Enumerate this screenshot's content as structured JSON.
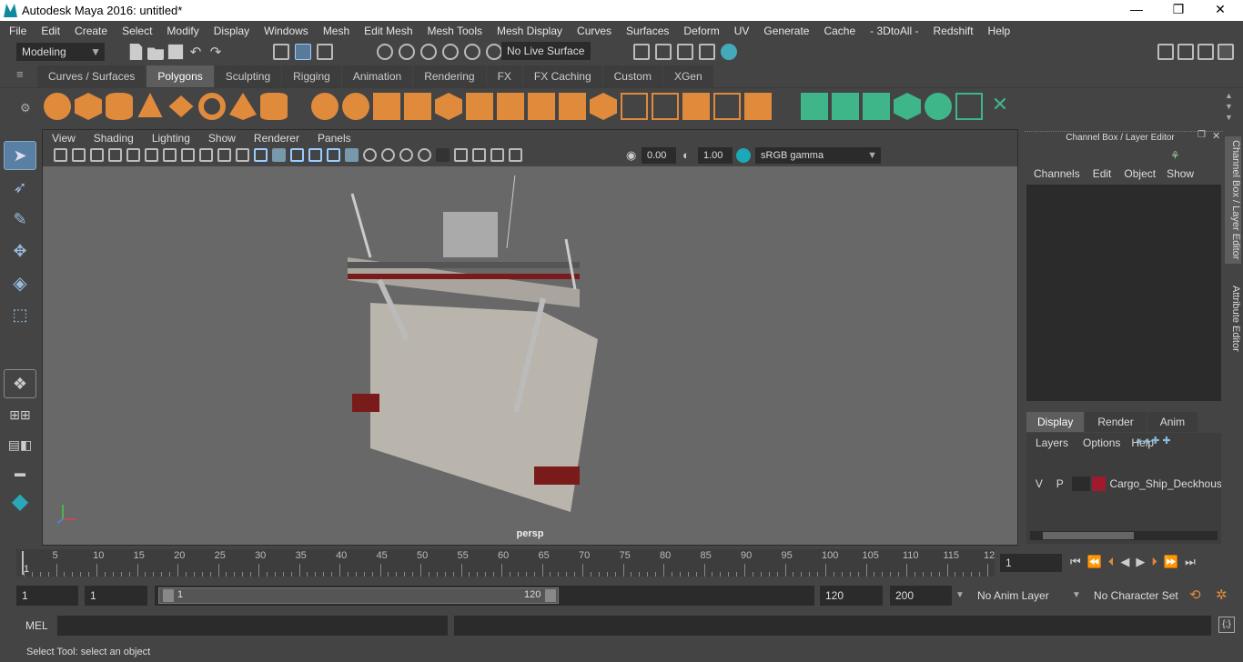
{
  "window": {
    "title": "Autodesk Maya 2016: untitled*",
    "minimize": "—",
    "maximize": "❐",
    "close": "✕"
  },
  "menu": [
    "File",
    "Edit",
    "Create",
    "Select",
    "Modify",
    "Display",
    "Windows",
    "Mesh",
    "Edit Mesh",
    "Mesh Tools",
    "Mesh Display",
    "Curves",
    "Surfaces",
    "Deform",
    "UV",
    "Generate",
    "Cache",
    "- 3DtoAll -",
    "Redshift",
    "Help"
  ],
  "status": {
    "mode": "Modeling",
    "live_surface": "No Live Surface"
  },
  "shelf_tabs": [
    "Curves / Surfaces",
    "Polygons",
    "Sculpting",
    "Rigging",
    "Animation",
    "Rendering",
    "FX",
    "FX Caching",
    "Custom",
    "XGen"
  ],
  "active_shelf": "Polygons",
  "panel_menu": [
    "View",
    "Shading",
    "Lighting",
    "Show",
    "Renderer",
    "Panels"
  ],
  "panel_tools": {
    "exposure": "0.00",
    "gamma": "1.00",
    "color_space": "sRGB gamma"
  },
  "viewport": {
    "camera": "persp"
  },
  "channel_box": {
    "title": "Channel Box / Layer Editor",
    "menu": [
      "Channels",
      "Edit",
      "Object",
      "Show"
    ],
    "layer_tabs": [
      "Display",
      "Render",
      "Anim"
    ],
    "active_layer_tab": "Display",
    "layer_menu": [
      "Layers",
      "Options",
      "Help"
    ],
    "layer": {
      "v": "V",
      "p": "P",
      "name": "Cargo_Ship_Deckhous",
      "color": "#9e1a2c"
    }
  },
  "side_tabs": [
    "Channel Box / Layer Editor",
    "Attribute Editor"
  ],
  "timeline": {
    "ticks": [
      "5",
      "10",
      "15",
      "20",
      "25",
      "30",
      "35",
      "40",
      "45",
      "50",
      "55",
      "60",
      "65",
      "70",
      "75",
      "80",
      "85",
      "90",
      "95",
      "100",
      "105",
      "110",
      "115",
      "12"
    ],
    "start_label": "1",
    "current_frame": "1"
  },
  "range": {
    "start": "1",
    "anim_start": "1",
    "slider_start": "1",
    "slider_end": "120",
    "end": "120",
    "anim_end": "200",
    "anim_layer": "No Anim Layer",
    "char_set": "No Character Set"
  },
  "command": {
    "label": "MEL"
  },
  "help_line": "Select Tool: select an object"
}
